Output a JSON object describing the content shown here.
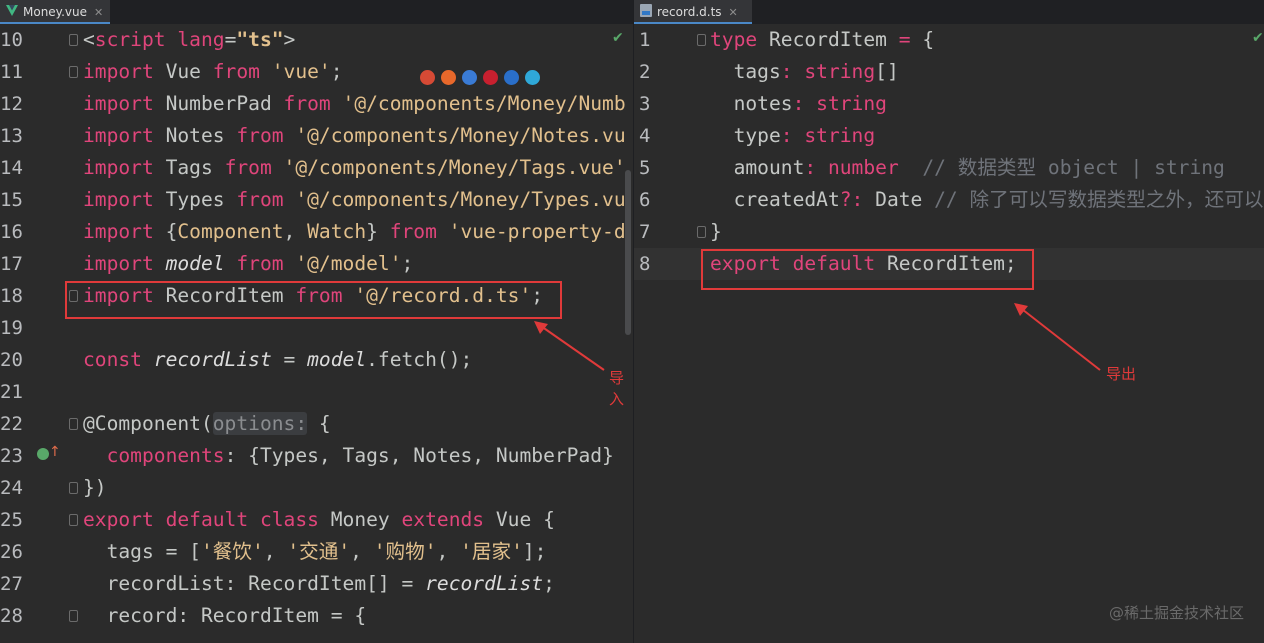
{
  "left_tab": {
    "name": "Money.vue",
    "close": "✕",
    "icon": "vue-icon"
  },
  "right_tab": {
    "name": "record.d.ts",
    "close": "✕",
    "icon": "ts-file-icon"
  },
  "left_lines": [
    {
      "n": "10"
    },
    {
      "n": "11"
    },
    {
      "n": "12"
    },
    {
      "n": "13"
    },
    {
      "n": "14"
    },
    {
      "n": "15"
    },
    {
      "n": "16"
    },
    {
      "n": "17"
    },
    {
      "n": "18"
    },
    {
      "n": "19"
    },
    {
      "n": "20"
    },
    {
      "n": "21"
    },
    {
      "n": "22"
    },
    {
      "n": "23"
    },
    {
      "n": "24"
    },
    {
      "n": "25"
    },
    {
      "n": "26"
    },
    {
      "n": "27"
    },
    {
      "n": "28"
    }
  ],
  "left_code": {
    "l10": {
      "a": "<",
      "b": "script",
      "c": " lang",
      "d": "=",
      "e": "\"ts\"",
      "f": ">"
    },
    "l11": {
      "a": "import",
      "b": " Vue ",
      "c": "from",
      "d": " 'vue'",
      "e": ";"
    },
    "l12": {
      "a": "import",
      "b": " NumberPad ",
      "c": "from",
      "d": " '@/components/Money/Numb"
    },
    "l13": {
      "a": "import",
      "b": " Notes ",
      "c": "from",
      "d": " '@/components/Money/Notes.vu"
    },
    "l14": {
      "a": "import",
      "b": " Tags ",
      "c": "from",
      "d": " '@/components/Money/Tags.vue'"
    },
    "l15": {
      "a": "import",
      "b": " Types ",
      "c": "from",
      "d": " '@/components/Money/Types.vu"
    },
    "l16": {
      "a": "import",
      "b": " {",
      "c": "Component",
      "d": ", ",
      "e": "Watch",
      "f": "} ",
      "g": "from",
      "h": " 'vue-property-d"
    },
    "l17": {
      "a": "import",
      "b": " ",
      "c": "model",
      "d": " ",
      "e": "from",
      "f": " '@/model'",
      "g": ";"
    },
    "l18": {
      "a": "import",
      "b": " RecordItem ",
      "c": "from",
      "d": " '@/record.d.ts'",
      "e": ";"
    },
    "l20": {
      "a": "const",
      "b": " ",
      "c": "recordList",
      "d": " = ",
      "e": "model",
      "f": ".fetch();"
    },
    "l22": {
      "a": "@Component(",
      "b": "options:",
      "c": " {"
    },
    "l23": {
      "a": "  components",
      "b": ": {Types, Tags, Notes, NumberPad}"
    },
    "l24": {
      "a": "})"
    },
    "l25": {
      "a": "export default class",
      "b": " Money ",
      "c": "extends",
      "d": " Vue {"
    },
    "l26": {
      "a": "  tags",
      "b": " = [",
      "c": "'餐饮'",
      "d": ", ",
      "e": "'交通'",
      "f": ", ",
      "g": "'购物'",
      "h": ", ",
      "i": "'居家'",
      "j": "];"
    },
    "l27": {
      "a": "  recordList",
      "b": ": RecordItem[] = ",
      "c": "recordList",
      "d": ";"
    },
    "l28": {
      "a": "  record",
      "b": ": RecordItem = {"
    }
  },
  "right_lines": [
    {
      "n": "1"
    },
    {
      "n": "2"
    },
    {
      "n": "3"
    },
    {
      "n": "4"
    },
    {
      "n": "5"
    },
    {
      "n": "6"
    },
    {
      "n": "7"
    },
    {
      "n": "8"
    }
  ],
  "right_code": {
    "r1": {
      "a": "type",
      "b": " RecordItem ",
      "c": "=",
      "d": " {"
    },
    "r2": {
      "a": "  tags",
      "b": ": ",
      "c": "string",
      "d": "[]"
    },
    "r3": {
      "a": "  notes",
      "b": ": ",
      "c": "string"
    },
    "r4": {
      "a": "  type",
      "b": ": ",
      "c": "string"
    },
    "r5": {
      "a": "  amount",
      "b": ": ",
      "c": "number",
      "d": "  // 数据类型 object | string"
    },
    "r6": {
      "a": "  createdAt",
      "b": "?: ",
      "c": "Date",
      "d": " // 除了可以写数据类型之外，还可以"
    },
    "r7": {
      "a": "}"
    },
    "r8": {
      "a": "export default",
      "b": " RecordItem",
      "c": ";"
    }
  },
  "annotations": {
    "import_label": "导入",
    "export_label": "导出"
  },
  "watermark": "@稀土掘金技术社区",
  "browser_icons": [
    "chrome-icon",
    "firefox-icon",
    "safari-icon",
    "opera-icon",
    "ie-icon",
    "edge-icon"
  ],
  "colors": {
    "keyword": "#e0457b",
    "string": "#e2c08d",
    "annotation": "#e03a3a",
    "background": "#2b2b2b"
  }
}
